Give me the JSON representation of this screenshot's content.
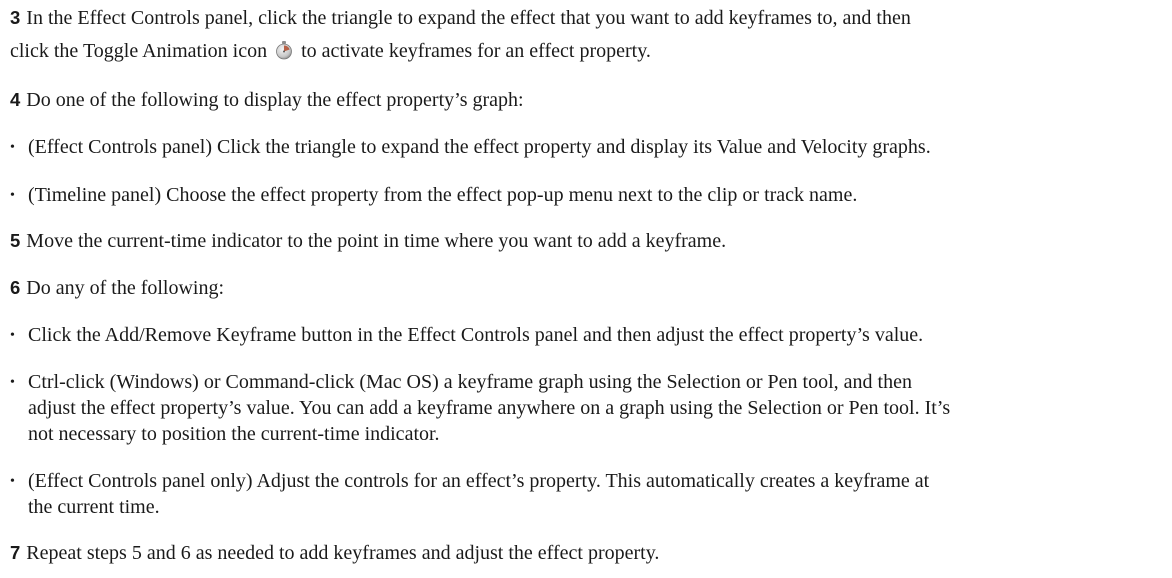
{
  "steps": {
    "step3": {
      "number": "3",
      "line1": "In the Effect Controls panel, click the triangle to expand the effect that you want to add keyframes to, and then",
      "line2_before": "click the Toggle Animation icon",
      "line2_after": "to activate keyframes for an effect property."
    },
    "step4": {
      "number": "4",
      "text": "Do one of the following to display the effect property’s graph:",
      "bullets": [
        "(Effect Controls panel) Click the triangle to expand the effect property and display its Value and Velocity graphs.",
        "(Timeline panel) Choose the effect property from the effect pop-up menu next to the clip or track name."
      ]
    },
    "step5": {
      "number": "5",
      "text": "Move the current-time indicator to the point in time where you want to add a keyframe."
    },
    "step6": {
      "number": "6",
      "text": "Do any of the following:",
      "bullet1": "Click the Add/Remove Keyframe button in the Effect Controls panel and then adjust the effect property’s value.",
      "bullet2_line1": "Ctrl-click (Windows) or Command-click (Mac OS) a keyframe graph using the Selection or Pen tool, and then",
      "bullet2_line2": "adjust the effect property’s value. You can add a keyframe anywhere on a graph using the Selection or Pen tool. It’s",
      "bullet2_line3": "not necessary to position the current-time indicator.",
      "bullet3_line1": "(Effect Controls panel only) Adjust the controls for an effect’s property. This automatically creates a keyframe at",
      "bullet3_line2": "the current time."
    },
    "step7": {
      "number": "7",
      "text": "Repeat steps 5 and 6 as needed to add keyframes and adjust the effect property."
    }
  },
  "bullet_char": "•",
  "icons": {
    "toggle_animation": "stopwatch-icon"
  }
}
